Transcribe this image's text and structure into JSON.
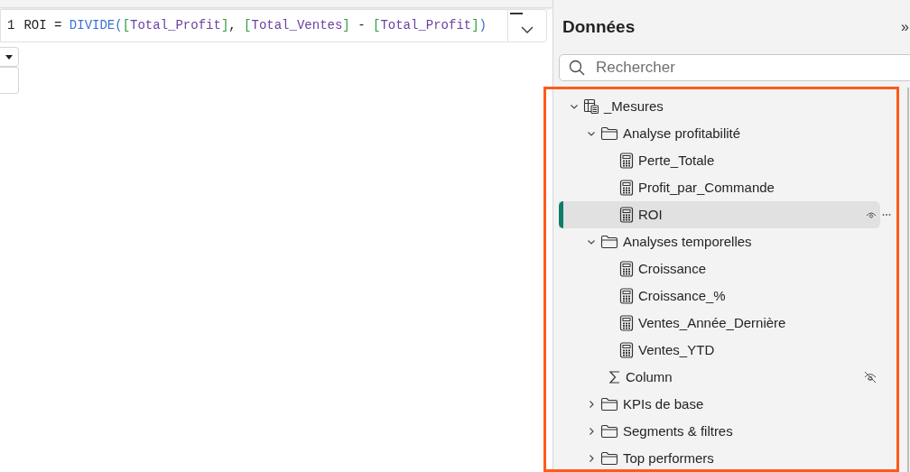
{
  "formula": {
    "line_number": "1",
    "tokens": [
      {
        "kind": "plain",
        "text": "ROI = "
      },
      {
        "kind": "func",
        "text": "DIVIDE"
      },
      {
        "kind": "paren",
        "text": "("
      },
      {
        "kind": "bracket",
        "text": "["
      },
      {
        "kind": "measure",
        "text": "Total_Profit"
      },
      {
        "kind": "bracket",
        "text": "]"
      },
      {
        "kind": "plain",
        "text": ", "
      },
      {
        "kind": "bracket",
        "text": "["
      },
      {
        "kind": "measure",
        "text": "Total_Ventes"
      },
      {
        "kind": "bracket",
        "text": "]"
      },
      {
        "kind": "plain",
        "text": " - "
      },
      {
        "kind": "bracket",
        "text": "["
      },
      {
        "kind": "measure",
        "text": "Total_Profit"
      },
      {
        "kind": "bracket",
        "text": "]"
      },
      {
        "kind": "paren",
        "text": ")"
      }
    ]
  },
  "data_pane": {
    "title": "Données",
    "collapse_glyph": "»",
    "search": {
      "placeholder": "Rechercher"
    },
    "tree": [
      {
        "kind": "table",
        "label": "_Mesures",
        "expanded": true,
        "selected": false,
        "children": [
          {
            "kind": "folder",
            "label": "Analyse profitabilité",
            "expanded": true,
            "selected": false,
            "children": [
              {
                "kind": "measure",
                "label": "Perte_Totale",
                "selected": false
              },
              {
                "kind": "measure",
                "label": "Profit_par_Commande",
                "selected": false
              },
              {
                "kind": "measure",
                "label": "ROI",
                "selected": true
              }
            ]
          },
          {
            "kind": "folder",
            "label": "Analyses temporelles",
            "expanded": true,
            "selected": false,
            "children": [
              {
                "kind": "measure",
                "label": "Croissance",
                "selected": false
              },
              {
                "kind": "measure",
                "label": "Croissance_%",
                "selected": false
              },
              {
                "kind": "measure",
                "label": "Ventes_Année_Dernière",
                "selected": false
              },
              {
                "kind": "measure",
                "label": "Ventes_YTD",
                "selected": false
              }
            ]
          },
          {
            "kind": "column",
            "label": "Column",
            "selected": false,
            "hidden": true
          },
          {
            "kind": "folder",
            "label": "KPIs de base",
            "expanded": false,
            "selected": false
          },
          {
            "kind": "folder",
            "label": "Segments & filtres",
            "expanded": false,
            "selected": false
          },
          {
            "kind": "folder",
            "label": "Top performers",
            "expanded": false,
            "selected": false
          }
        ]
      }
    ]
  }
}
